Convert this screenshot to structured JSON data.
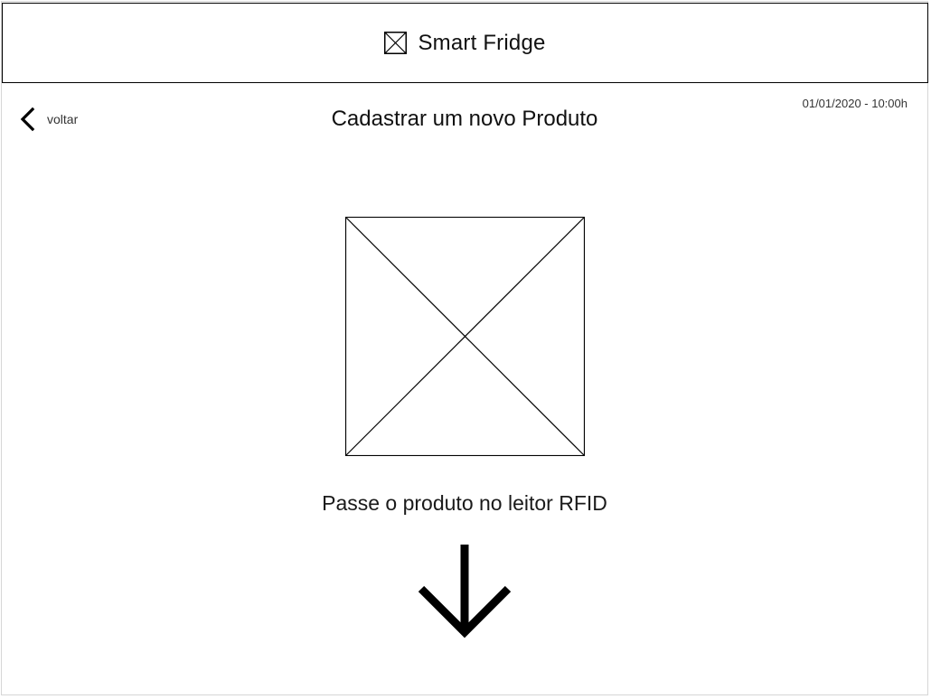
{
  "header": {
    "app_title": "Smart Fridge",
    "logo_icon": "image-placeholder-icon"
  },
  "nav": {
    "back_label": "voltar",
    "back_icon": "chevron-left-icon"
  },
  "status": {
    "datetime": "01/01/2020 - 10:00h"
  },
  "main": {
    "title": "Cadastrar um novo Produto",
    "image_placeholder": "image-placeholder-icon",
    "instruction": "Passe o produto no leitor RFID",
    "arrow_icon": "arrow-down-icon"
  },
  "colors": {
    "stroke": "#000000",
    "background": "#ffffff",
    "text": "#1a1a1a"
  }
}
